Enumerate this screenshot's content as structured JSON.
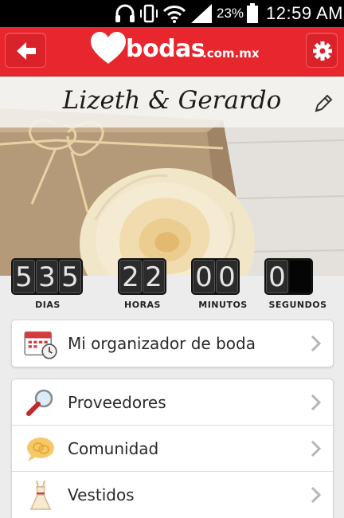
{
  "status_bar": {
    "battery_percent": "23%",
    "time": "12:59 AM"
  },
  "header": {
    "brand": "bodas",
    "brand_domain": ".com.mx"
  },
  "hero": {
    "couple_names": "Lizeth & Gerardo"
  },
  "countdown": {
    "groups": [
      {
        "label": "DIAS",
        "digits": [
          "5",
          "3",
          "5"
        ]
      },
      {
        "label": "HORAS",
        "digits": [
          "2",
          "2"
        ]
      },
      {
        "label": "MINUTOS",
        "digits": [
          "0",
          "0"
        ]
      },
      {
        "label": "SEGUNDOS",
        "digits": [
          "0",
          ""
        ]
      }
    ]
  },
  "menu": {
    "organizer": {
      "label": "Mi organizador de boda",
      "icon": "calendar-clock-icon"
    },
    "items": [
      {
        "label": "Proveedores",
        "icon": "magnifier-icon"
      },
      {
        "label": "Comunidad",
        "icon": "chat-bubbles-icon"
      },
      {
        "label": "Vestidos",
        "icon": "dress-icon"
      }
    ]
  },
  "colors": {
    "brand_red": "#e8262e",
    "status_bar": "#000000"
  }
}
